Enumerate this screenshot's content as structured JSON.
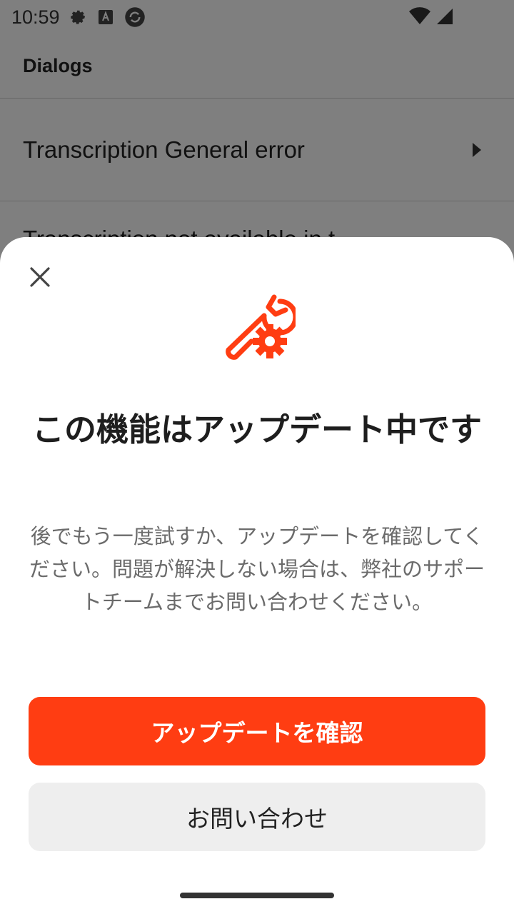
{
  "status_bar": {
    "time": "10:59",
    "icons": [
      "gear-icon",
      "font-a-icon",
      "sync-circle-icon"
    ],
    "right_icons": [
      "wifi-icon",
      "signal-icon"
    ]
  },
  "app": {
    "header_title": "Dialogs",
    "rows": [
      {
        "label": "Transcription General error"
      },
      {
        "label": "Transcription not available in t"
      }
    ]
  },
  "sheet": {
    "title": "この機能はアップデート中です",
    "body": "後でもう一度試すか、アップデートを確認してください。問題が解決しない場合は、弊社のサポートチームまでお問い合わせください。",
    "primary_button": "アップデートを確認",
    "secondary_button": "お問い合わせ",
    "accent_color": "#ff3d12",
    "hero_icon": "wrench-gear-icon"
  }
}
